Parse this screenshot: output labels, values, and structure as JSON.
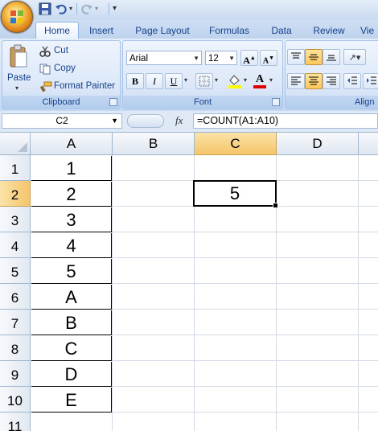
{
  "ribbon": {
    "tabs": [
      "Home",
      "Insert",
      "Page Layout",
      "Formulas",
      "Data",
      "Review",
      "Vie"
    ],
    "active_tab": "Home",
    "clipboard": {
      "paste": "Paste",
      "cut": "Cut",
      "copy": "Copy",
      "format_painter": "Format Painter",
      "label": "Clipboard"
    },
    "font": {
      "font_name": "Arial",
      "font_size": "12",
      "bold": "B",
      "italic": "I",
      "underline": "U",
      "label": "Font",
      "font_color": "#e00000",
      "fill_color": "#ffff00"
    },
    "alignment": {
      "label": "Align"
    }
  },
  "formula_bar": {
    "name_box": "C2",
    "fx": "fx",
    "formula": "=COUNT(A1:A10)"
  },
  "sheet": {
    "columns": [
      "A",
      "B",
      "C",
      "D"
    ],
    "selected_column": "C",
    "rows": [
      "1",
      "2",
      "3",
      "4",
      "5",
      "6",
      "7",
      "8",
      "9",
      "10",
      "11"
    ],
    "selected_row": "2",
    "column_a_values": [
      "1",
      "2",
      "3",
      "4",
      "5",
      "A",
      "B",
      "C",
      "D",
      "E"
    ],
    "active_cell_value": "5"
  },
  "colors": {
    "ribbon_blue": "#c5d9f2",
    "selection_header": "#f5c569",
    "text_blue": "#15428b"
  }
}
